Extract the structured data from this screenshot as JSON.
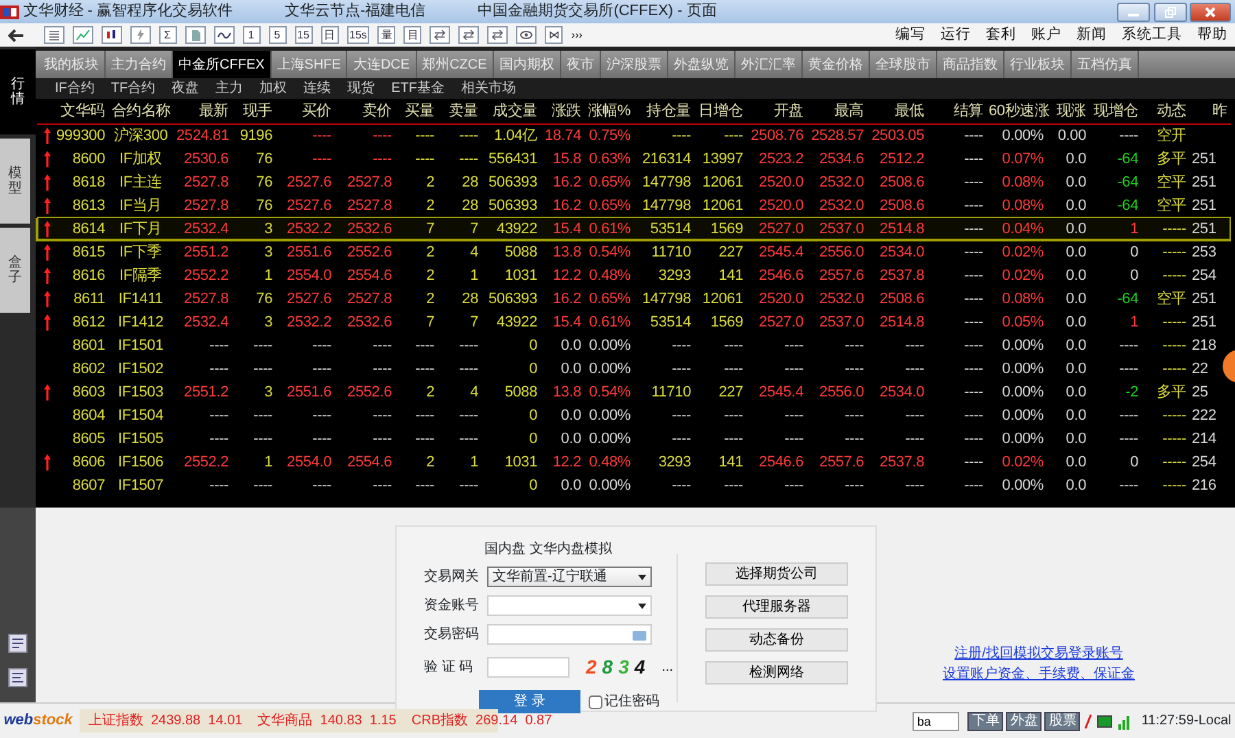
{
  "window": {
    "titles": [
      "文华财经  -  赢智程序化交易软件",
      "文华云节点-福建电信",
      "中国金融期货交易所(CFFEX)  -  页面"
    ]
  },
  "toolbar": {
    "items": [
      {
        "kind": "arrow"
      },
      {
        "kind": "grid"
      },
      {
        "kind": "chart"
      },
      {
        "kind": "bars"
      },
      {
        "kind": "bolt"
      },
      {
        "kind": "text",
        "label": "Σ"
      },
      {
        "kind": "doc"
      },
      {
        "kind": "wave"
      },
      {
        "kind": "text",
        "label": "1"
      },
      {
        "kind": "text",
        "label": "5"
      },
      {
        "kind": "text",
        "label": "15"
      },
      {
        "kind": "text",
        "label": "日"
      },
      {
        "kind": "text",
        "label": "15s"
      },
      {
        "kind": "text",
        "label": "量"
      },
      {
        "kind": "text",
        "label": "目"
      },
      {
        "kind": "swap"
      },
      {
        "kind": "swap"
      },
      {
        "kind": "swap"
      },
      {
        "kind": "eye"
      },
      {
        "kind": "text",
        "label": "⋈"
      },
      {
        "kind": "more",
        "label": "›››"
      }
    ],
    "menu": [
      "编写",
      "运行",
      "套利",
      "账户",
      "新闻",
      "系统工具",
      "帮助"
    ]
  },
  "side_tabs": [
    {
      "label": "行情",
      "selected": true
    },
    {
      "label": "模型",
      "selected": false
    },
    {
      "label": "盒子",
      "selected": false
    }
  ],
  "market_tabs": [
    {
      "label": "我的板块",
      "selected": false
    },
    {
      "label": "主力合约",
      "selected": false
    },
    {
      "label": "中金所CFFEX",
      "selected": true
    },
    {
      "label": "上海SHFE",
      "selected": false
    },
    {
      "label": "大连DCE",
      "selected": false
    },
    {
      "label": "郑州CZCE",
      "selected": false
    },
    {
      "label": "国内期权",
      "selected": false
    },
    {
      "label": "夜市",
      "selected": false
    },
    {
      "label": "沪深股票",
      "selected": false
    },
    {
      "label": "外盘纵览",
      "selected": false
    },
    {
      "label": "外汇汇率",
      "selected": false
    },
    {
      "label": "黄金价格",
      "selected": false
    },
    {
      "label": "全球股市",
      "selected": false
    },
    {
      "label": "商品指数",
      "selected": false
    },
    {
      "label": "行业板块",
      "selected": false
    },
    {
      "label": "五档仿真",
      "selected": false
    }
  ],
  "sub_tabs": [
    "IF合约",
    "TF合约",
    "夜盘",
    "主力",
    "加权",
    "连续",
    "现货",
    "ETF基金",
    "相关市场"
  ],
  "table": {
    "columns": [
      {
        "label": "文华码",
        "kind": "code"
      },
      {
        "label": "合约名称",
        "kind": "name"
      },
      {
        "label": "最新",
        "kind": "price"
      },
      {
        "label": "现手",
        "kind": "qty"
      },
      {
        "label": "买价",
        "kind": "price"
      },
      {
        "label": "卖价",
        "kind": "price"
      },
      {
        "label": "买量",
        "kind": "qty"
      },
      {
        "label": "卖量",
        "kind": "qty"
      },
      {
        "label": "成交量",
        "kind": "vol"
      },
      {
        "label": "涨跌",
        "kind": "price"
      },
      {
        "label": "涨幅%",
        "kind": "price"
      },
      {
        "label": "持仓量",
        "kind": "qty"
      },
      {
        "label": "日增仓",
        "kind": "qty"
      },
      {
        "label": "开盘",
        "kind": "price"
      },
      {
        "label": "最高",
        "kind": "price"
      },
      {
        "label": "最低",
        "kind": "price"
      },
      {
        "label": "结算",
        "kind": "plain"
      },
      {
        "label": "60秒速涨",
        "kind": "sign"
      },
      {
        "label": "现涨",
        "kind": "plain"
      },
      {
        "label": "现增仓",
        "kind": "sign"
      },
      {
        "label": "动态",
        "kind": "vol"
      },
      {
        "label": "昨",
        "kind": "plain"
      }
    ],
    "rows": [
      {
        "up": true,
        "selected": false,
        "cells": [
          "999300",
          "沪深300",
          "2524.81",
          "9196",
          "----",
          "----",
          "----",
          "----",
          "1.04亿",
          "18.74",
          "0.75%",
          "----",
          "----",
          "2508.76",
          "2528.57",
          "2503.05",
          "----",
          "0.00%",
          "0.00",
          "----",
          "空开",
          null
        ]
      },
      {
        "up": true,
        "selected": false,
        "cells": [
          "8600",
          "IF加权",
          "2530.6",
          "76",
          "----",
          "----",
          "----",
          "----",
          "556431",
          "15.8",
          "0.63%",
          "216314",
          "13997",
          "2523.2",
          "2534.6",
          "2512.2",
          "----",
          "0.07%",
          "0.0",
          "-64",
          "多平",
          "251"
        ]
      },
      {
        "up": true,
        "selected": false,
        "cells": [
          "8618",
          "IF主连",
          "2527.8",
          "76",
          "2527.6",
          "2527.8",
          "2",
          "28",
          "506393",
          "16.2",
          "0.65%",
          "147798",
          "12061",
          "2520.0",
          "2532.0",
          "2508.6",
          "----",
          "0.08%",
          "0.0",
          "-64",
          "空平",
          "251"
        ]
      },
      {
        "up": true,
        "selected": false,
        "cells": [
          "8613",
          "IF当月",
          "2527.8",
          "76",
          "2527.6",
          "2527.8",
          "2",
          "28",
          "506393",
          "16.2",
          "0.65%",
          "147798",
          "12061",
          "2520.0",
          "2532.0",
          "2508.6",
          "----",
          "0.08%",
          "0.0",
          "-64",
          "空平",
          "251"
        ]
      },
      {
        "up": true,
        "selected": true,
        "cells": [
          "8614",
          "IF下月",
          "2532.4",
          "3",
          "2532.2",
          "2532.6",
          "7",
          "7",
          "43922",
          "15.4",
          "0.61%",
          "53514",
          "1569",
          "2527.0",
          "2537.0",
          "2514.8",
          "----",
          "0.04%",
          "0.0",
          "1",
          "-----",
          "251"
        ]
      },
      {
        "up": true,
        "selected": false,
        "cells": [
          "8615",
          "IF下季",
          "2551.2",
          "3",
          "2551.6",
          "2552.6",
          "2",
          "4",
          "5088",
          "13.8",
          "0.54%",
          "11710",
          "227",
          "2545.4",
          "2556.0",
          "2534.0",
          "----",
          "0.02%",
          "0.0",
          "0",
          "-----",
          "253"
        ]
      },
      {
        "up": true,
        "selected": false,
        "cells": [
          "8616",
          "IF隔季",
          "2552.2",
          "1",
          "2554.0",
          "2554.6",
          "2",
          "1",
          "1031",
          "12.2",
          "0.48%",
          "3293",
          "141",
          "2546.6",
          "2557.6",
          "2537.8",
          "----",
          "0.02%",
          "0.0",
          "0",
          "-----",
          "254"
        ]
      },
      {
        "up": true,
        "selected": false,
        "cells": [
          "8611",
          "IF1411",
          "2527.8",
          "76",
          "2527.6",
          "2527.8",
          "2",
          "28",
          "506393",
          "16.2",
          "0.65%",
          "147798",
          "12061",
          "2520.0",
          "2532.0",
          "2508.6",
          "----",
          "0.08%",
          "0.0",
          "-64",
          "空平",
          "251"
        ]
      },
      {
        "up": true,
        "selected": false,
        "cells": [
          "8612",
          "IF1412",
          "2532.4",
          "3",
          "2532.2",
          "2532.6",
          "7",
          "7",
          "43922",
          "15.4",
          "0.61%",
          "53514",
          "1569",
          "2527.0",
          "2537.0",
          "2514.8",
          "----",
          "0.05%",
          "0.0",
          "1",
          "-----",
          "251"
        ]
      },
      {
        "up": false,
        "selected": false,
        "cells": [
          "8601",
          "IF1501",
          "----",
          "----",
          "----",
          "----",
          "----",
          "----",
          "0",
          "0.0",
          "0.00%",
          "----",
          "----",
          "----",
          "----",
          "----",
          "----",
          "0.00%",
          "0.0",
          "----",
          "-----",
          "218"
        ]
      },
      {
        "up": false,
        "selected": false,
        "cells": [
          "8602",
          "IF1502",
          "----",
          "----",
          "----",
          "----",
          "----",
          "----",
          "0",
          "0.0",
          "0.00%",
          "----",
          "----",
          "----",
          "----",
          "----",
          "----",
          "0.00%",
          "0.0",
          "----",
          "-----",
          "22"
        ]
      },
      {
        "up": true,
        "selected": false,
        "cells": [
          "8603",
          "IF1503",
          "2551.2",
          "3",
          "2551.6",
          "2552.6",
          "2",
          "4",
          "5088",
          "13.8",
          "0.54%",
          "11710",
          "227",
          "2545.4",
          "2556.0",
          "2534.0",
          "----",
          "0.00%",
          "0.0",
          "-2",
          "多平",
          "25"
        ]
      },
      {
        "up": false,
        "selected": false,
        "cells": [
          "8604",
          "IF1504",
          "----",
          "----",
          "----",
          "----",
          "----",
          "----",
          "0",
          "0.0",
          "0.00%",
          "----",
          "----",
          "----",
          "----",
          "----",
          "----",
          "0.00%",
          "0.0",
          "----",
          "-----",
          "222"
        ]
      },
      {
        "up": false,
        "selected": false,
        "cells": [
          "8605",
          "IF1505",
          "----",
          "----",
          "----",
          "----",
          "----",
          "----",
          "0",
          "0.0",
          "0.00%",
          "----",
          "----",
          "----",
          "----",
          "----",
          "----",
          "0.00%",
          "0.0",
          "----",
          "-----",
          "214"
        ]
      },
      {
        "up": true,
        "selected": false,
        "cells": [
          "8606",
          "IF1506",
          "2552.2",
          "1",
          "2554.0",
          "2554.6",
          "2",
          "1",
          "1031",
          "12.2",
          "0.48%",
          "3293",
          "141",
          "2546.6",
          "2557.6",
          "2537.8",
          "----",
          "0.02%",
          "0.0",
          "0",
          "-----",
          "254"
        ]
      },
      {
        "up": false,
        "selected": false,
        "cells": [
          "8607",
          "IF1507",
          "----",
          "----",
          "----",
          "----",
          "----",
          "----",
          "0",
          "0.0",
          "0.00%",
          "----",
          "----",
          "----",
          "----",
          "----",
          "----",
          "0.00%",
          "0.0",
          "----",
          "-----",
          "216"
        ]
      }
    ]
  },
  "login": {
    "mode": "国内盘  文华内盘模拟",
    "fields": [
      {
        "label": "交易网关",
        "kind": "select",
        "value": "文华前置-辽宁联通"
      },
      {
        "label": "资金账号",
        "kind": "select"
      },
      {
        "label": "交易密码",
        "kind": "password"
      },
      {
        "label": "验 证 码",
        "kind": "captcha"
      }
    ],
    "captcha": [
      {
        "char": "2",
        "color": "#f04a1e"
      },
      {
        "char": "8",
        "color": "#1e9a3c"
      },
      {
        "char": "3",
        "color": "#3cb43c"
      },
      {
        "char": "4",
        "color": "#141414"
      }
    ],
    "refresh": "...",
    "submit": "登 录",
    "remember": {
      "label": "记住密码",
      "checked": false
    },
    "buttons": [
      "选择期货公司",
      "代理服务器",
      "动态备份",
      "检测网络"
    ]
  },
  "links": [
    "注册/找回模拟交易登录账号",
    "设置账户资金、手续费、保证金"
  ],
  "status_bar": {
    "logo": [
      "web",
      "stock"
    ],
    "indices": [
      {
        "name": "上证指数",
        "value": "2439.88  14.01"
      },
      {
        "name": "文华商品",
        "value": "140.83  1.15"
      },
      {
        "name": "CRB指数",
        "value": "269.14  0.87"
      }
    ],
    "input": "ba",
    "buttons": [
      "下单",
      "外盘",
      "股票"
    ],
    "time": "11:27:59-Local"
  }
}
